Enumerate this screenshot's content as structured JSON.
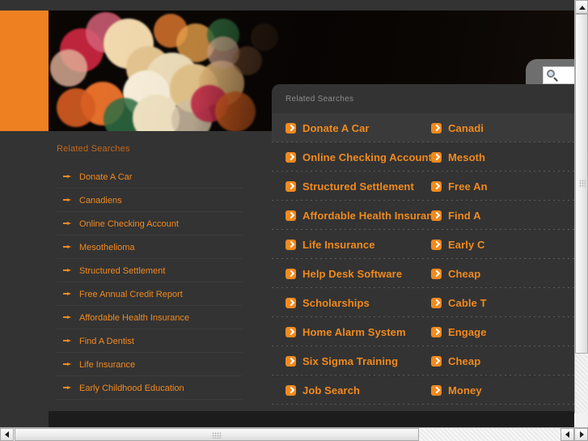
{
  "banner": {
    "alt_description": "bokeh-lights-banner"
  },
  "search": {
    "value": "",
    "placeholder": "",
    "icon": "magnifier-icon"
  },
  "background_panel": {
    "title": "Related Searches",
    "items": [
      {
        "label": "Donate A Car",
        "icon": "arrow-bullet-icon"
      },
      {
        "label": "Canadiens",
        "icon": "arrow-bullet-icon"
      },
      {
        "label": "Online Checking Account",
        "icon": "arrow-bullet-icon"
      },
      {
        "label": "Mesothelioma",
        "icon": "arrow-bullet-icon"
      },
      {
        "label": "Structured Settlement",
        "icon": "arrow-bullet-icon"
      },
      {
        "label": "Free Annual Credit Report",
        "icon": "arrow-bullet-icon"
      },
      {
        "label": "Affordable Health Insurance",
        "icon": "arrow-bullet-icon"
      },
      {
        "label": "Find A Dentist",
        "icon": "arrow-bullet-icon"
      },
      {
        "label": "Life Insurance",
        "icon": "arrow-bullet-icon"
      },
      {
        "label": "Early Childhood Education",
        "icon": "arrow-bullet-icon"
      }
    ]
  },
  "overlay_panel": {
    "title": "Related Searches",
    "rows": [
      {
        "left": "Donate A Car",
        "right": "Canadi"
      },
      {
        "left": "Online Checking Account",
        "right": "Mesoth"
      },
      {
        "left": "Structured Settlement",
        "right": "Free An"
      },
      {
        "left": "Affordable Health Insurance",
        "right": "Find A "
      },
      {
        "left": "Life Insurance",
        "right": "Early C"
      },
      {
        "left": "Help Desk Software",
        "right": "Cheap "
      },
      {
        "left": "Scholarships",
        "right": "Cable T"
      },
      {
        "left": "Home Alarm System",
        "right": "Engage"
      },
      {
        "left": "Six Sigma Training",
        "right": "Cheap "
      },
      {
        "left": "Job Search",
        "right": "Money "
      }
    ],
    "row_icon": "chevron-right-square-icon"
  },
  "colors": {
    "accent_orange": "#f08a1e",
    "block_orange": "#ef8022",
    "panel_bg": "#333333",
    "muted_title": "#8d8d8d"
  },
  "scrollbars": {
    "vertical": {
      "up_icon": "triangle-up-icon",
      "down_icon": "triangle-down-icon"
    },
    "horizontal": {
      "left_icon": "triangle-left-icon",
      "right_icon": "triangle-right-icon"
    }
  }
}
